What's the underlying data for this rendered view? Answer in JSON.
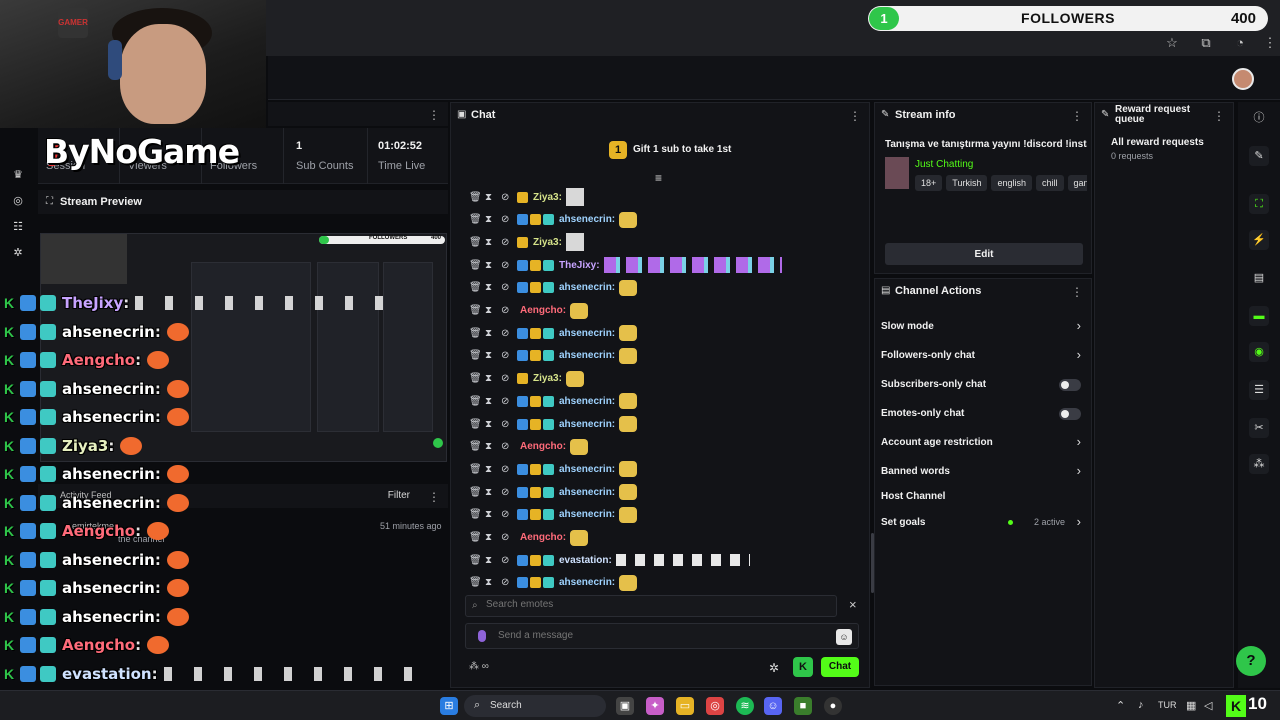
{
  "followers_bar": {
    "badge": "1",
    "label": "FOLLOWERS",
    "count": "400"
  },
  "overlay": {
    "logo_text": "ByNoGame",
    "cam_logo": "GAMER"
  },
  "stats": [
    {
      "value": "",
      "label": "Session"
    },
    {
      "value": "",
      "label": "Viewers"
    },
    {
      "value": "",
      "label": "Followers"
    },
    {
      "value": "1",
      "label": "Sub Counts"
    },
    {
      "value": "01:02:52",
      "label": "Time Live"
    }
  ],
  "preview": {
    "title": "Stream Preview",
    "bar_label": "FOLLOWERS",
    "bar_count": "400"
  },
  "activity": {
    "title": "Activity Feed",
    "filter_label": "Filter",
    "user": "emirtekme",
    "time": "51 minutes ago",
    "subtext": "the channel"
  },
  "overlay_chat": [
    {
      "name": "TheJixy",
      "color": "#c7a3ff",
      "emote": "strip"
    },
    {
      "name": "ahsenecrin",
      "color": "#ffffff",
      "emote": "cat"
    },
    {
      "name": "Aengcho",
      "color": "#ff6b7a",
      "emote": "cat"
    },
    {
      "name": "ahsenecrin",
      "color": "#ffffff",
      "emote": "cat"
    },
    {
      "name": "ahsenecrin",
      "color": "#ffffff",
      "emote": "cat"
    },
    {
      "name": "Ziya3",
      "color": "#e6f0c0",
      "emote": "cat"
    },
    {
      "name": "ahsenecrin",
      "color": "#ffffff",
      "emote": "cat"
    },
    {
      "name": "ahsenecrin",
      "color": "#ffffff",
      "emote": "cat"
    },
    {
      "name": "Aengcho",
      "color": "#ff6b7a",
      "emote": "cat"
    },
    {
      "name": "ahsenecrin",
      "color": "#ffffff",
      "emote": "cat"
    },
    {
      "name": "ahsenecrin",
      "color": "#ffffff",
      "emote": "cat"
    },
    {
      "name": "ahsenecrin",
      "color": "#ffffff",
      "emote": "cat"
    },
    {
      "name": "Aengcho",
      "color": "#ff6b7a",
      "emote": "cat"
    },
    {
      "name": "evastation",
      "color": "#cfe2ff",
      "emote": "strip"
    },
    {
      "name": "ahsenecrin",
      "color": "#ffffff",
      "emote": "cat"
    }
  ],
  "chat": {
    "title": "Chat",
    "gift_badge": "1",
    "gift_text": "Gift 1 sub to take 1st",
    "messages": [
      {
        "name": "Ziya3:",
        "color": "#d6e38a",
        "badges": 1,
        "emote": "img"
      },
      {
        "name": "ahsenecrin:",
        "color": "#9fd3ff",
        "badges": 3,
        "emote": "cat"
      },
      {
        "name": "Ziya3:",
        "color": "#d6e38a",
        "badges": 1,
        "emote": "img"
      },
      {
        "name": "TheJixy:",
        "color": "#c7a3ff",
        "badges": 3,
        "emote": "strip"
      },
      {
        "name": "ahsenecrin:",
        "color": "#9fd3ff",
        "badges": 3,
        "emote": "cat"
      },
      {
        "name": "Aengcho:",
        "color": "#ff6b7a",
        "badges": 0,
        "emote": "cat"
      },
      {
        "name": "ahsenecrin:",
        "color": "#9fd3ff",
        "badges": 3,
        "emote": "cat"
      },
      {
        "name": "ahsenecrin:",
        "color": "#9fd3ff",
        "badges": 3,
        "emote": "cat"
      },
      {
        "name": "Ziya3:",
        "color": "#d6e38a",
        "badges": 1,
        "emote": "cat"
      },
      {
        "name": "ahsenecrin:",
        "color": "#9fd3ff",
        "badges": 3,
        "emote": "cat"
      },
      {
        "name": "ahsenecrin:",
        "color": "#9fd3ff",
        "badges": 3,
        "emote": "cat"
      },
      {
        "name": "Aengcho:",
        "color": "#ff6b7a",
        "badges": 0,
        "emote": "cat"
      },
      {
        "name": "ahsenecrin:",
        "color": "#9fd3ff",
        "badges": 3,
        "emote": "cat"
      },
      {
        "name": "ahsenecrin:",
        "color": "#9fd3ff",
        "badges": 3,
        "emote": "cat"
      },
      {
        "name": "ahsenecrin:",
        "color": "#9fd3ff",
        "badges": 3,
        "emote": "cat"
      },
      {
        "name": "Aengcho:",
        "color": "#ff6b7a",
        "badges": 0,
        "emote": "cat"
      },
      {
        "name": "evastation:",
        "color": "#cfe2ff",
        "badges": 3,
        "emote": "strip-white"
      },
      {
        "name": "ahsenecrin:",
        "color": "#9fd3ff",
        "badges": 3,
        "emote": "cat"
      }
    ],
    "emote_search_placeholder": "Search emotes",
    "message_placeholder": "Send a message",
    "send_label": "Chat",
    "k_button": "K",
    "infinity": "∞"
  },
  "stream_info": {
    "title": "Stream info",
    "stream_title": "Tanışma ve tanıştırma yayını !discord !insta",
    "category": "Just Chatting",
    "tags": [
      "18+",
      "Turkish",
      "english",
      "chill",
      "gan"
    ],
    "edit_label": "Edit"
  },
  "channel_actions": {
    "title": "Channel Actions",
    "items": [
      {
        "label": "Slow mode",
        "control": "chevron"
      },
      {
        "label": "Followers-only chat",
        "control": "chevron"
      },
      {
        "label": "Subscribers-only chat",
        "control": "toggle"
      },
      {
        "label": "Emotes-only chat",
        "control": "toggle"
      },
      {
        "label": "Account age restriction",
        "control": "chevron"
      },
      {
        "label": "Banned words",
        "control": "chevron"
      },
      {
        "label": "Host Channel",
        "control": "none"
      },
      {
        "label": "Set goals",
        "control": "chevron",
        "status": "2 active"
      }
    ]
  },
  "reward_queue": {
    "title": "Reward request queue",
    "all_label": "All reward requests",
    "count": "0 requests"
  },
  "taskbar": {
    "search_label": "Search",
    "lang": "TUR",
    "time": "10"
  },
  "colors": {
    "accent": "#53fc18",
    "panel": "#121317",
    "background": "#0b0c0f"
  }
}
